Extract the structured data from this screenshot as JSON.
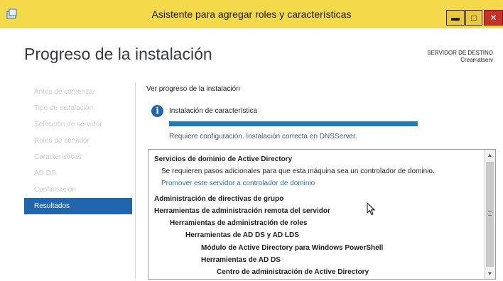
{
  "window": {
    "title": "Asistente para agregar roles y características",
    "icon": "server-manager-icon",
    "controls": {
      "minimize": "minimize-icon",
      "maximize": "maximize-icon",
      "close": "close-icon"
    }
  },
  "header": {
    "page_title": "Progreso de la instalación",
    "destination_label": "SERVIDOR DE DESTINO",
    "destination_server": "Creamatserv"
  },
  "nav": {
    "items": [
      {
        "label": "Antes de comenzar"
      },
      {
        "label": "Tipo de instalación"
      },
      {
        "label": "Selección de servidor"
      },
      {
        "label": "Roles de servidor"
      },
      {
        "label": "Características"
      },
      {
        "label": "AD DS"
      },
      {
        "label": "Confirmación"
      },
      {
        "label": "Resultados",
        "active": true
      }
    ]
  },
  "main": {
    "heading": "Ver progreso de la instalación",
    "install_label": "Instalación de característica",
    "progress_fraction": 1.0,
    "result_text": "Requiere configuración. Instalación correcta en DNSServer.",
    "results": [
      {
        "text": "Servicios de dominio de Active Directory",
        "bold": true,
        "level": 0
      },
      {
        "text": "Se requieren pasos adicionales para que esta máquina sea un controlador de dominio.",
        "level": 1
      },
      {
        "text": "Promover este servidor a controlador de dominio",
        "link": true,
        "level": 1
      },
      {
        "text": "Administración de directivas de grupo",
        "bold": true,
        "level": 0
      },
      {
        "text": "Herramientas de administración remota del servidor",
        "bold": true,
        "level": 0
      },
      {
        "text": "Herramientas de administración de roles",
        "bold": true,
        "level": 1
      },
      {
        "text": "Herramientas de AD DS y AD LDS",
        "bold": true,
        "level": 2
      },
      {
        "text": "Módulo de Active Directory para Windows PowerShell",
        "bold": true,
        "level": 3
      },
      {
        "text": "Herramientas de AD DS",
        "bold": true,
        "level": 3
      },
      {
        "text": "Centro de administración de Active Directory",
        "bold": true,
        "level": 4
      }
    ]
  },
  "colors": {
    "titlebar": "#f4d94a",
    "accent": "#2166ad",
    "progress": "#1f7bb0",
    "link": "#2b6cb0"
  }
}
